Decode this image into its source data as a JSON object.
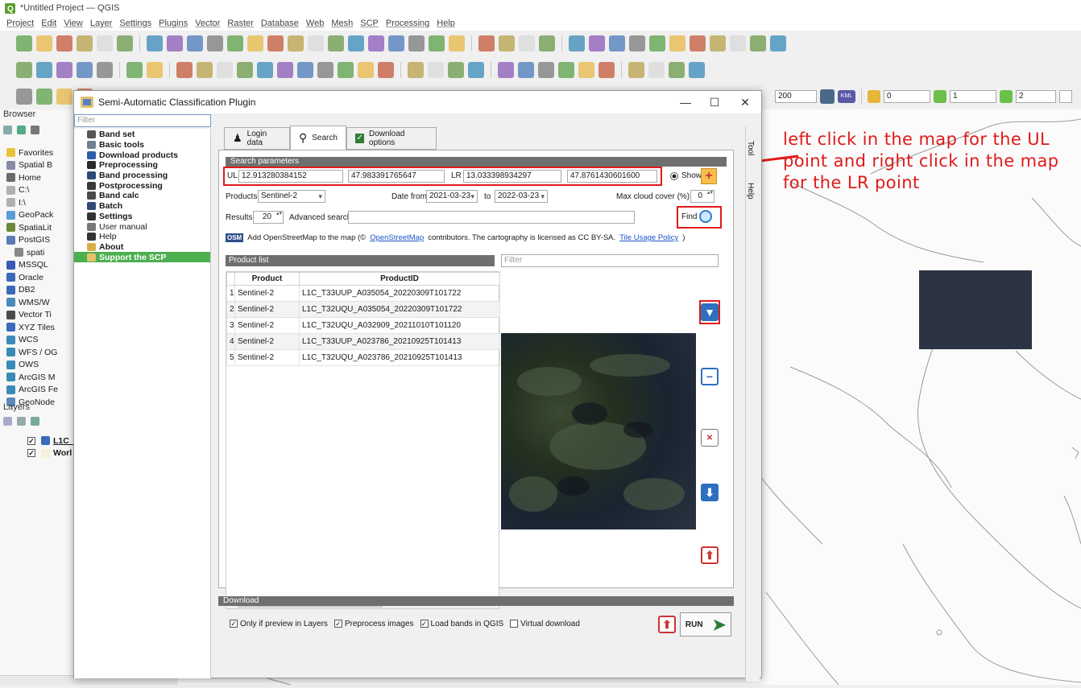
{
  "window": {
    "title": "*Untitled Project — QGIS"
  },
  "menubar": [
    "Project",
    "Edit",
    "View",
    "Layer",
    "Settings",
    "Plugins",
    "Vector",
    "Raster",
    "Database",
    "Web",
    "Mesh",
    "SCP",
    "Processing",
    "Help"
  ],
  "toolbar": {
    "spin_200": "200",
    "kml_label": "KML",
    "spin_0": "0",
    "spin_1": "1",
    "spin_2": "2"
  },
  "browser": {
    "title": "Browser",
    "items": [
      "Favorites",
      "Spatial B",
      "Home",
      "C:\\",
      "I:\\",
      "GeoPack",
      "SpatiaLit",
      "PostGIS",
      "spati",
      "MSSQL",
      "Oracle",
      "DB2",
      "WMS/W",
      "Vector Ti",
      "XYZ Tiles",
      "WCS",
      "WFS / OG",
      "OWS",
      "ArcGIS M",
      "ArcGIS Fe",
      "GeoNode"
    ]
  },
  "layers": {
    "title": "Layers",
    "items": [
      {
        "label": "L1C_",
        "checked": true
      },
      {
        "label": "Worl",
        "checked": true
      }
    ]
  },
  "scp": {
    "title": "Semi-Automatic Classification Plugin",
    "menu_filter_placeholder": "Filter",
    "menu_items": [
      {
        "label": "Band set",
        "style": "bold",
        "icon": "band-set-icon",
        "color": "#555555"
      },
      {
        "label": "Basic tools",
        "style": "bold",
        "icon": "basic-tools-icon",
        "color": "#6f7f92"
      },
      {
        "label": "Download products",
        "style": "bold",
        "icon": "download-icon",
        "color": "#2f5da8"
      },
      {
        "label": "Preprocessing",
        "style": "bold",
        "icon": "preprocessing-icon",
        "color": "#2a2a2a"
      },
      {
        "label": "Band processing",
        "style": "bold",
        "icon": "band-processing-icon",
        "color": "#2a4a7a"
      },
      {
        "label": "Postprocessing",
        "style": "bold",
        "icon": "postprocessing-icon",
        "color": "#3a3a3a"
      },
      {
        "label": "Band calc",
        "style": "bold",
        "icon": "band-calc-icon",
        "color": "#4a4a4a"
      },
      {
        "label": "Batch",
        "style": "bold",
        "icon": "batch-icon",
        "color": "#2f4a78"
      },
      {
        "label": "Settings",
        "style": "bold",
        "icon": "settings-icon",
        "color": "#333333"
      },
      {
        "label": "User manual",
        "style": "light",
        "icon": "manual-icon",
        "color": "#777777"
      },
      {
        "label": "Help",
        "style": "light",
        "icon": "help-icon",
        "color": "#333333"
      },
      {
        "label": "About",
        "style": "bold",
        "icon": "about-icon",
        "color": "#d8b04a"
      },
      {
        "label": "Support the SCP",
        "style": "bold",
        "icon": "support-icon",
        "color": "#e5c16a",
        "selected": true
      }
    ],
    "tabs": [
      "Login data",
      "Search",
      "Download options"
    ],
    "search_section": "Search parameters",
    "ul_label": "UL",
    "ul_x": "12.913280384152",
    "ul_y": "47.983391765647",
    "lr_label": "LR",
    "lr_x": "13.033398934297",
    "lr_y": "47.8761430601600",
    "show_label": "Show",
    "products_label": "Products",
    "products_value": "Sentinel-2",
    "date_from_label": "Date from",
    "date_from": "2021-03-23",
    "to_label": "to",
    "date_to": "2022-03-23",
    "cloud_label": "Max cloud cover (%)",
    "cloud_value": "0",
    "results_label": "Results",
    "results_value": "20",
    "advanced_label": "Advanced search",
    "find_label": "Find",
    "osm_badge": "OSM",
    "osm_prefix": "Add OpenStreetMap to the map  (©",
    "osm_link": "OpenStreetMap",
    "osm_middle": "contributors. The cartography is licensed as CC BY-SA.",
    "tile_link": "Tile Usage Policy",
    "osm_suffix": ")",
    "product_list_label": "Product list",
    "filter_placeholder": "Filter",
    "columns": [
      "Product",
      "ProductID"
    ],
    "rows": [
      {
        "n": "1",
        "product": "Sentinel-2",
        "id": "L1C_T33UUP_A035054_20220309T101722"
      },
      {
        "n": "2",
        "product": "Sentinel-2",
        "id": "L1C_T32UQU_A035054_20220309T101722"
      },
      {
        "n": "3",
        "product": "Sentinel-2",
        "id": "L1C_T32UQU_A032909_20211010T101120"
      },
      {
        "n": "4",
        "product": "Sentinel-2",
        "id": "L1C_T33UUP_A023786_20210925T101413"
      },
      {
        "n": "5",
        "product": "Sentinel-2",
        "id": "L1C_T32UQU_A023786_20210925T101413"
      }
    ],
    "download_section": "Download",
    "only_preview_label": "Only if preview in Layers",
    "preprocess_label": "Preprocess images",
    "load_bands_label": "Load bands in QGIS",
    "virtual_label": "Virtual download",
    "run_label": "RUN",
    "dock_tool": "Tool",
    "dock_help": "Help"
  },
  "annotation": "left click in the map for the UL point and right click in the map for the LR point",
  "colors": {
    "highlight_red": "#e11a1a",
    "scp_green": "#4caf50",
    "section_gray": "#6f6f6f"
  }
}
